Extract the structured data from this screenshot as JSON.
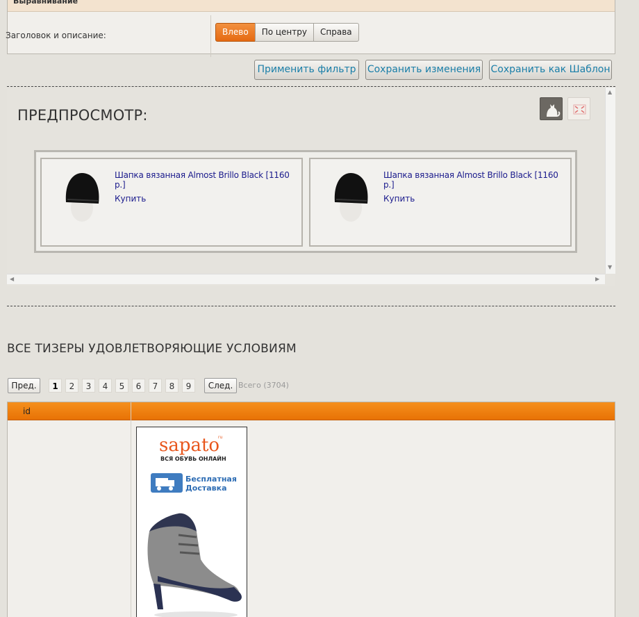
{
  "alignment": {
    "section_title": "Выравнивание",
    "row_label": "Заголовок и описание:",
    "options": [
      "Влево",
      "По центру",
      "Справа"
    ],
    "selected": "Влево"
  },
  "actions": {
    "apply_filter": "Применить фильтр",
    "save_changes": "Сохранить изменения",
    "save_as_template": "Сохранить как Шаблон"
  },
  "preview": {
    "title": "ПРЕДПРОСМОТР:",
    "teasers": [
      {
        "title": "Шапка вязанная Almost Brillo Black [1160 р.]",
        "buy": "Купить"
      },
      {
        "title": "Шапка вязанная Almost Brillo Black [1160 р.]",
        "buy": "Купить"
      }
    ]
  },
  "listing": {
    "title": "ВСЕ ТИЗЕРЫ УДОВЛЕТВОРЯЮЩИЕ УСЛОВИЯМ",
    "prev": "Пред.",
    "next": "След.",
    "pages": [
      "1",
      "2",
      "3",
      "4",
      "5",
      "6",
      "7",
      "8",
      "9"
    ],
    "current_page": "1",
    "total": "Всего (3704)",
    "table": {
      "columns": [
        "id",
        ""
      ]
    }
  },
  "banner": {
    "brand": "sapato",
    "brand_sup": "ru",
    "tagline": "ВСЯ ОБУВЬ ОНЛАЙН",
    "delivery_line1": "Бесплатная",
    "delivery_line2": "Доставка"
  },
  "colors": {
    "accent_orange": "#e87205",
    "link_blue": "#1a7ea8",
    "teaser_link": "#1a1a8c"
  }
}
